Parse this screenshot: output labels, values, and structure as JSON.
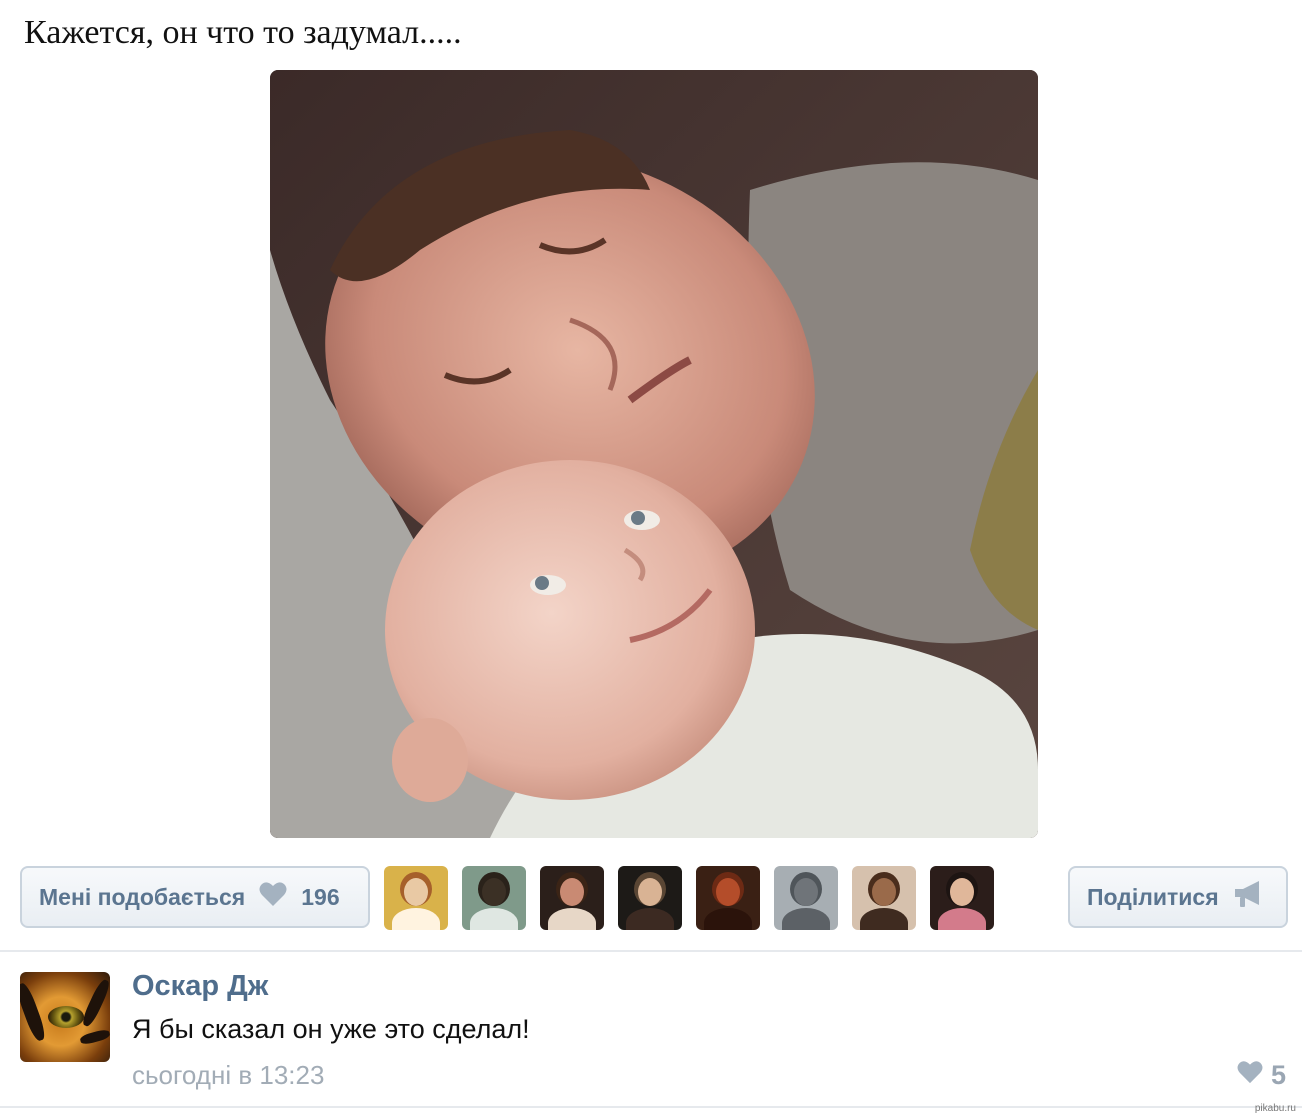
{
  "post": {
    "text": "Кажется, он что то задумал....."
  },
  "actions": {
    "like_label": "Мені подобається",
    "like_count": "196",
    "share_label": "Поділитися"
  },
  "likers": [
    {
      "name": "liker-1",
      "bg": "#d9b24a",
      "head": "#e9c9a4",
      "hair": "#a6602b",
      "body": "#fff3e0"
    },
    {
      "name": "liker-2",
      "bg": "#7f9a8a",
      "head": "#3b3025",
      "hair": "#2a221a",
      "body": "#dfe7e2"
    },
    {
      "name": "liker-3",
      "bg": "#2b1f1a",
      "head": "#c98a73",
      "hair": "#3b2416",
      "body": "#e7d7c7"
    },
    {
      "name": "liker-4",
      "bg": "#1d1a17",
      "head": "#d9b394",
      "hair": "#5a4634",
      "body": "#3c2a22"
    },
    {
      "name": "liker-5",
      "bg": "#3a2014",
      "head": "#b44d2a",
      "hair": "#6d2a14",
      "body": "#2b130b"
    },
    {
      "name": "liker-6",
      "bg": "#a7aeb3",
      "head": "#6f7479",
      "hair": "#4f555a",
      "body": "#5c6166"
    },
    {
      "name": "liker-7",
      "bg": "#d6c1ad",
      "head": "#9a6a4a",
      "hair": "#4a2d1c",
      "body": "#3f2b20"
    },
    {
      "name": "liker-8",
      "bg": "#2b1d1a",
      "head": "#e0b79a",
      "hair": "#1d1412",
      "body": "#d37b8b"
    }
  ],
  "comment": {
    "author": "Оскар Дж",
    "text": "Я бы сказал он уже это сделал!",
    "time": "сьогодні в 13:23",
    "likes": "5"
  },
  "watermark": "pikabu.ru",
  "colors": {
    "link": "#4f6d8c",
    "button_text": "#5b7590",
    "muted": "#a2acb6"
  }
}
